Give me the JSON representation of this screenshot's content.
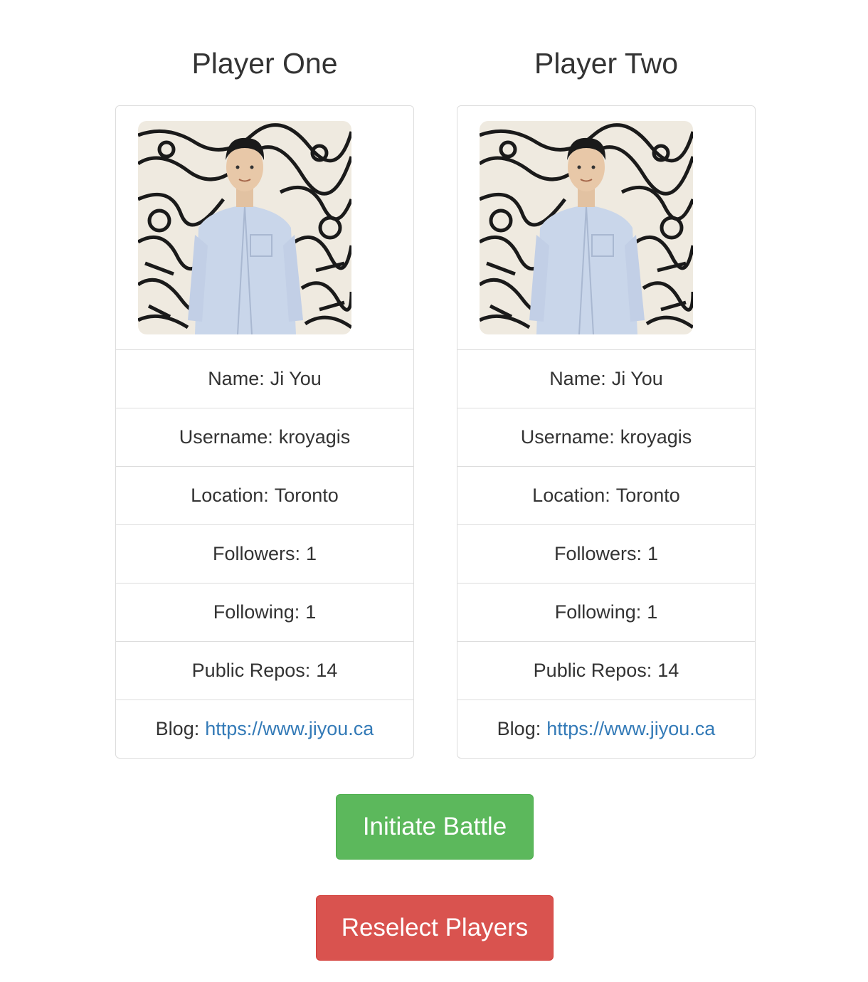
{
  "players": [
    {
      "heading": "Player One",
      "avatar_alt": "Avatar for kroyagis",
      "name_label": "Name:",
      "name": "Ji You",
      "username_label": "Username:",
      "username": "kroyagis",
      "location_label": "Location:",
      "location": "Toronto",
      "followers_label": "Followers:",
      "followers": "1",
      "following_label": "Following:",
      "following": "1",
      "repos_label": "Public Repos:",
      "repos": "14",
      "blog_label": "Blog:",
      "blog": "https://www.jiyou.ca"
    },
    {
      "heading": "Player Two",
      "avatar_alt": "Avatar for kroyagis",
      "name_label": "Name:",
      "name": "Ji You",
      "username_label": "Username:",
      "username": "kroyagis",
      "location_label": "Location:",
      "location": "Toronto",
      "followers_label": "Followers:",
      "followers": "1",
      "following_label": "Following:",
      "following": "1",
      "repos_label": "Public Repos:",
      "repos": "14",
      "blog_label": "Blog:",
      "blog": "https://www.jiyou.ca"
    }
  ],
  "actions": {
    "initiate_label": "Initiate Battle",
    "reselect_label": "Reselect Players"
  },
  "colors": {
    "success": "#5cb85c",
    "danger": "#d9534f",
    "link": "#337ab7",
    "border": "#dddddd"
  }
}
